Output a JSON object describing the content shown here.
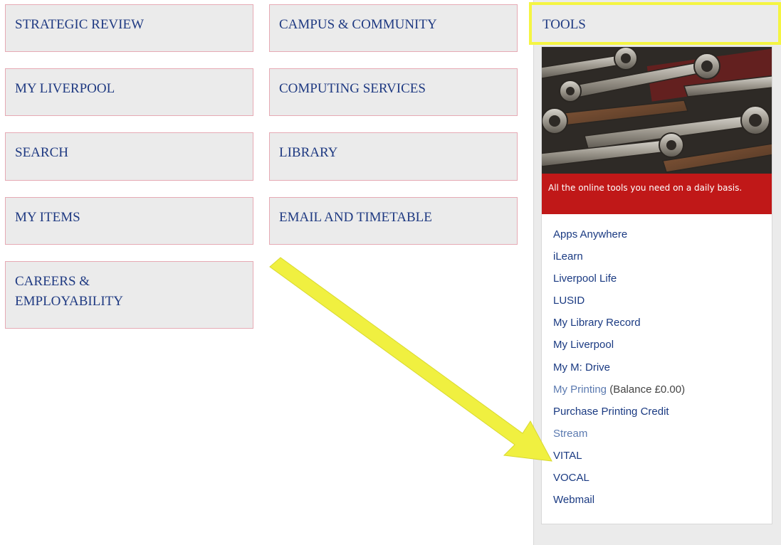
{
  "tiles_left": [
    "STRATEGIC REVIEW",
    "MY LIVERPOOL",
    "SEARCH",
    "MY ITEMS",
    [
      "CAREERS &",
      "EMPLOYABILITY"
    ]
  ],
  "tiles_right": [
    "CAMPUS & COMMUNITY",
    "COMPUTING SERVICES",
    "LIBRARY",
    "EMAIL AND TIMETABLE"
  ],
  "tools": {
    "title": "TOOLS",
    "image_icon": "tools-photo-icon",
    "caption": "All the online tools you need on a daily basis.",
    "links": [
      {
        "label": "Apps Anywhere"
      },
      {
        "label": "iLearn"
      },
      {
        "label": "Liverpool Life"
      },
      {
        "label": "LUSID"
      },
      {
        "label": "My Library Record"
      },
      {
        "label": "My Liverpool"
      },
      {
        "label": "My M: Drive"
      },
      {
        "label": "My Printing",
        "note": "(Balance £0.00)"
      },
      {
        "label": "Purchase Printing Credit"
      },
      {
        "label": "Stream"
      },
      {
        "label": "VITAL"
      },
      {
        "label": "VOCAL"
      },
      {
        "label": "Webmail"
      }
    ]
  },
  "colors": {
    "highlight": "#f5f542",
    "arrow": "#f0f040",
    "caption_bg": "#c01818",
    "link": "#1a3a82"
  }
}
